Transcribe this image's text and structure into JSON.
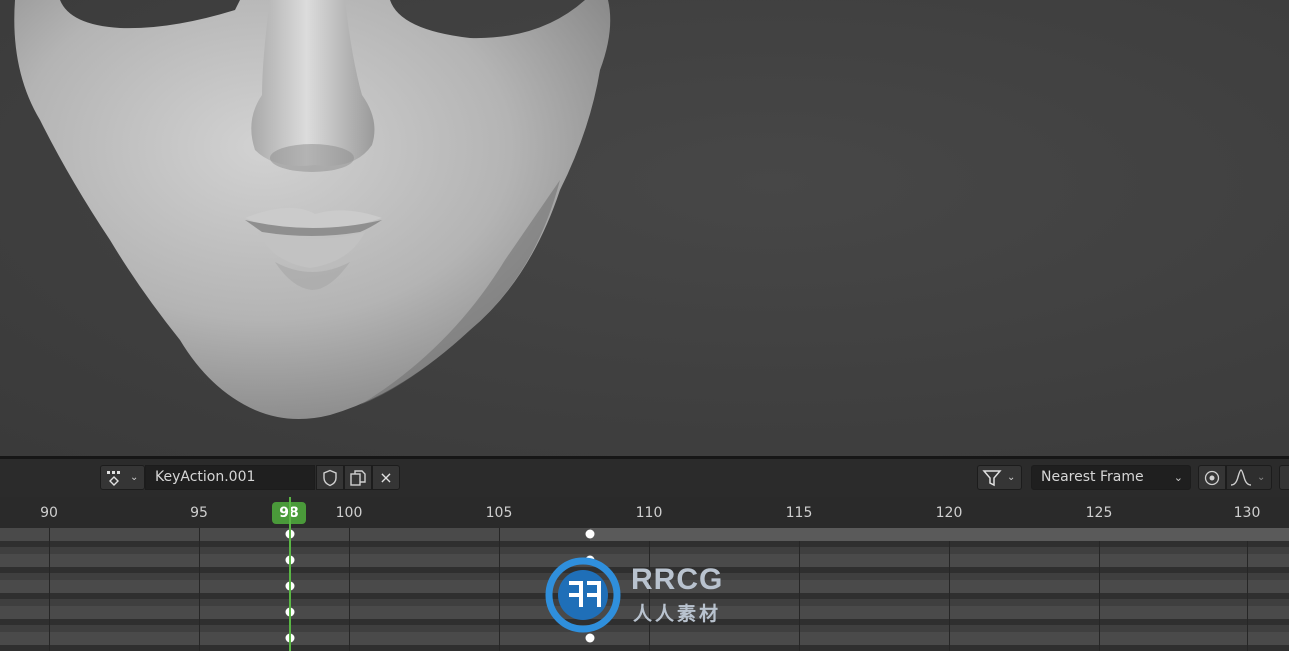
{
  "header": {
    "action_name": "KeyAction.001",
    "close_label": "×",
    "snap_mode": "Nearest Frame"
  },
  "timeline": {
    "current_frame": "98",
    "tick_labels": [
      "90",
      "95",
      "100",
      "105",
      "110",
      "115",
      "120",
      "125",
      "130"
    ]
  },
  "watermark": {
    "title": "RRCG",
    "subtitle": "人人素材"
  },
  "icons": [
    "action-mode-icon",
    "chevron-down-icon",
    "shield-icon",
    "duplicate-icon",
    "close-icon",
    "filter-icon",
    "proportional-edit-icon",
    "falloff-curve-icon"
  ],
  "colors": {
    "playhead": "#5ab645",
    "background": "#3a3a3a"
  }
}
